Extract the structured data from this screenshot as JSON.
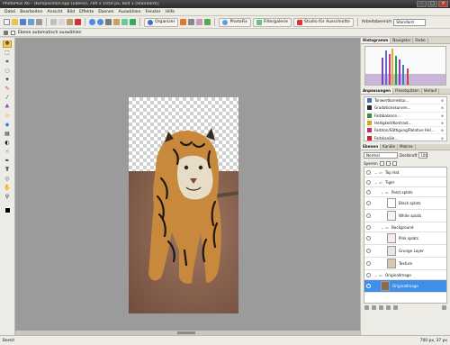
{
  "window": {
    "title": "PhotoPlus X6 - [Komposition.spp (Ebene), 700 x 1050 px, Bild 1 (Standard)]",
    "min": "–",
    "max": "□",
    "close": "×"
  },
  "menu": [
    "Datei",
    "Bearbeiten",
    "Ansicht",
    "Bild",
    "Effekte",
    "Ebenen",
    "Auswählen",
    "Fenster",
    "Hilfe"
  ],
  "toolbar": {
    "organizer": "Organizer",
    "photofix": "PhotoFix",
    "filtergalerie": "Filtergalerie",
    "studio": "Studio für Ausschnitte",
    "arbeitsbereich_label": "Arbeitsbereich",
    "arbeitsbereich_value": "Standard"
  },
  "options_bar": {
    "auto_select_label": "Ebene automatisch auswählen"
  },
  "right_panel": {
    "top_tabs": [
      "Histogramm",
      "Navigator",
      "Farbe"
    ],
    "adj_tabs": [
      "Anpassungen",
      "Pinselspitzen",
      "Verlauf"
    ],
    "adjustments": [
      {
        "label": "Tonwertkorrektur...",
        "color": "#4a6fb8"
      },
      {
        "label": "Gradationskurven...",
        "color": "#2a2a2a"
      },
      {
        "label": "Farbbalance...",
        "color": "#3b8f3b"
      },
      {
        "label": "Helligkeit/Kontrast...",
        "color": "#e0a020"
      },
      {
        "label": "Farbton/Sättigung/Relative Hel...",
        "color": "#c03060"
      },
      {
        "label": "Farbkanäle...",
        "color": "#d02020"
      }
    ],
    "adj_action": "⊕",
    "layer_tabs": [
      "Ebenen",
      "Kanäle",
      "Makros"
    ],
    "blend_mode": "Normal",
    "opacity_label": "Deckkraft",
    "opacity_value": "100",
    "lock_label": "Sperren"
  },
  "layers": [
    {
      "name": "Top Hat",
      "indent": 0,
      "group": true,
      "sel": false,
      "tall": false
    },
    {
      "name": "Tiger",
      "indent": 0,
      "group": true,
      "sel": false,
      "tall": false
    },
    {
      "name": "Paint splats",
      "indent": 1,
      "group": true,
      "sel": false,
      "tall": false
    },
    {
      "name": "Black splats",
      "indent": 2,
      "group": false,
      "sel": false,
      "tall": true,
      "thumb": "#ffffff"
    },
    {
      "name": "White splats",
      "indent": 2,
      "group": false,
      "sel": false,
      "tall": true,
      "thumb": "#f4f4f4"
    },
    {
      "name": "Background",
      "indent": 1,
      "group": true,
      "sel": false,
      "tall": false
    },
    {
      "name": "Pink splats",
      "indent": 2,
      "group": false,
      "sel": false,
      "tall": true,
      "thumb": "#f7e9ec"
    },
    {
      "name": "Grunge Layer",
      "indent": 2,
      "group": false,
      "sel": false,
      "tall": true,
      "thumb": "#e6e6e6"
    },
    {
      "name": "Texture",
      "indent": 2,
      "group": false,
      "sel": false,
      "tall": true,
      "thumb": "#d8c7a8"
    },
    {
      "name": "OriginalImage",
      "indent": 0,
      "group": true,
      "sel": false,
      "tall": false
    },
    {
      "name": "OriginalImage",
      "indent": 1,
      "group": false,
      "sel": true,
      "tall": true,
      "thumb": "#8a6a52"
    }
  ],
  "status": {
    "left": "Bereit",
    "right": "700 px, 37 px"
  }
}
